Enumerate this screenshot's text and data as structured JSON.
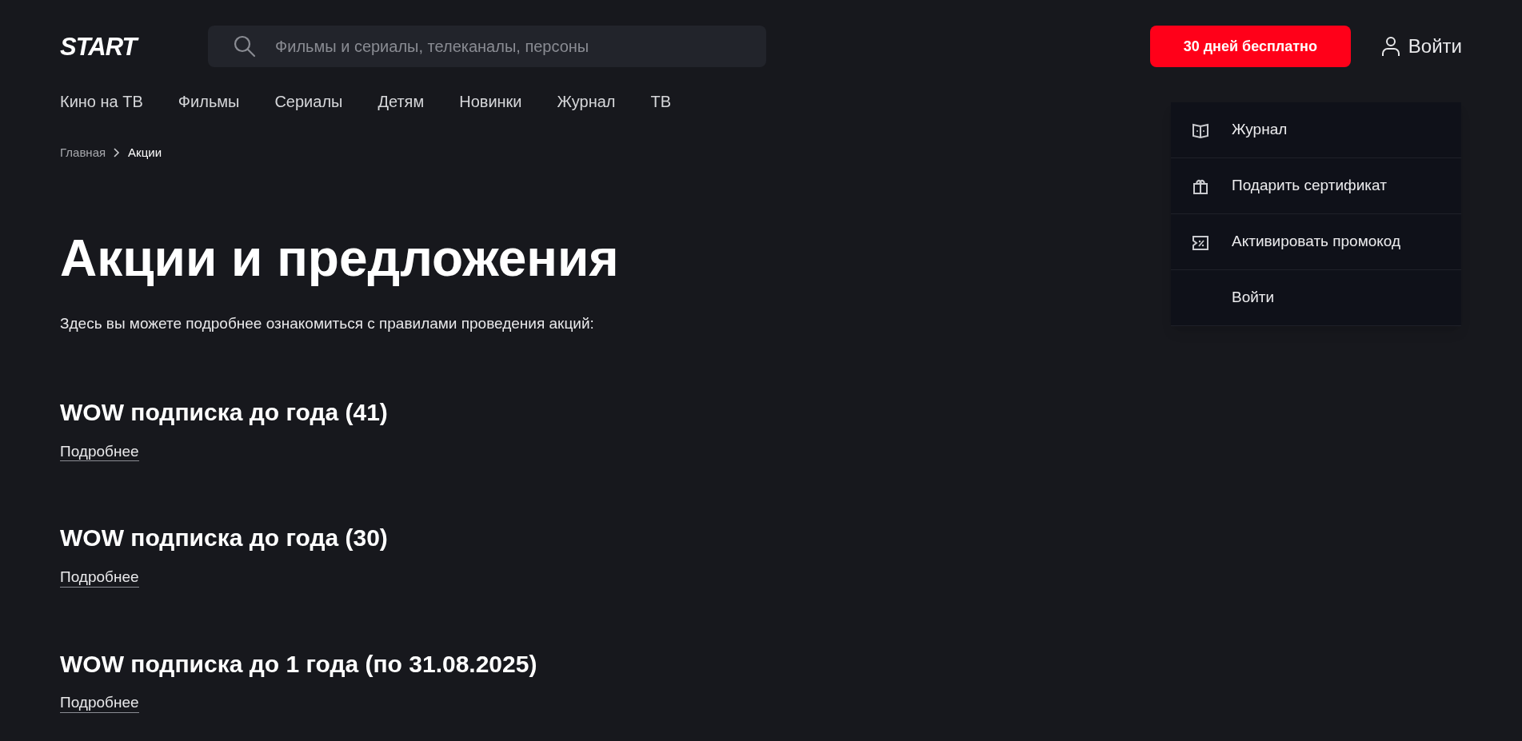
{
  "header": {
    "logo": "START",
    "search": {
      "placeholder": "Фильмы и сериалы, телеканалы, персоны"
    },
    "promo_button": "30 дней бесплатно",
    "login": "Войти"
  },
  "nav": [
    "Кино на ТВ",
    "Фильмы",
    "Сериалы",
    "Детям",
    "Новинки",
    "Журнал",
    "ТВ"
  ],
  "breadcrumbs": [
    "Главная",
    "Акции"
  ],
  "title": "Акции и предложения",
  "description": "Здесь вы можете подробнее ознакомиться с правилами проведения акций:",
  "promotions": [
    {
      "title": "WOW подписка до года (41)",
      "link": "Подробнее"
    },
    {
      "title": "WOW подписка до года (30)",
      "link": "Подробнее"
    },
    {
      "title": "WOW подписка до 1 года (по 31.08.2025)",
      "link": "Подробнее"
    }
  ],
  "menu": [
    {
      "label": "Журнал",
      "kind": "book"
    },
    {
      "label": "Подарить сертификат",
      "kind": "gift"
    },
    {
      "label": "Активировать промокод",
      "kind": "ticket"
    },
    {
      "label": "Войти",
      "kind": "plain"
    }
  ]
}
